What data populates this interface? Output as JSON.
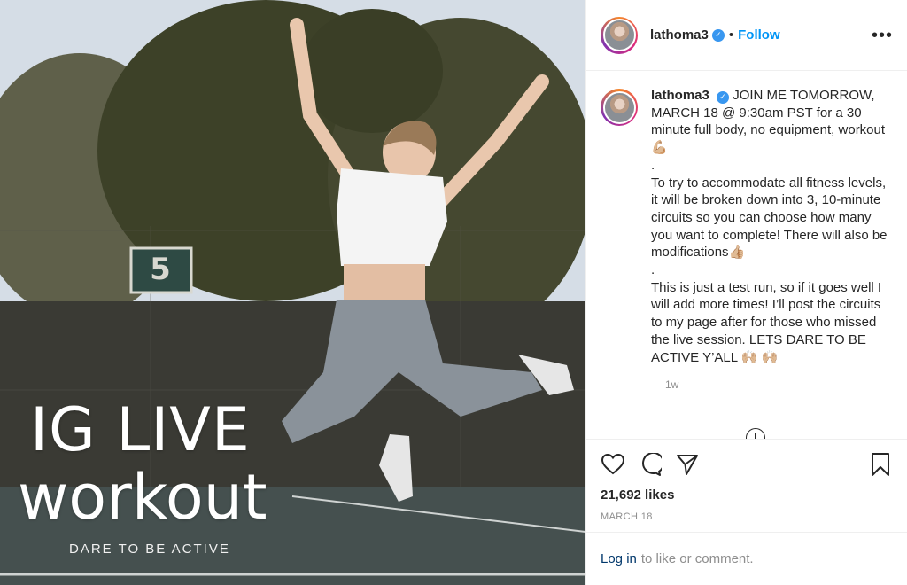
{
  "post": {
    "overlay_title": "IG LIVE",
    "overlay_subtitle": "workout",
    "overlay_tagline": "DARE TO BE ACTIVE",
    "court_sign": "5"
  },
  "header": {
    "username": "lathoma3",
    "verified_icon": "verified-badge-icon",
    "separator": "•",
    "follow_label": "Follow",
    "more_label": "•••"
  },
  "caption": {
    "username": "lathoma3",
    "text": "JOIN ME TOMORROW, MARCH 18 @ 9:30am PST for a 30 minute full body, no equipment, workout 💪🏼\n.\nTo try to accommodate all fitness levels, it will be broken down into 3, 10-minute circuits so you can choose how many you want to complete! There will also be modifications👍🏼\n.\nThis is just a test run, so if it goes well I will add more times! I’ll post the circuits to my page after for those who missed the live session. LETS DARE TO BE ACTIVE Y’ALL 🙌🏼 🙌🏼",
    "time": "1w"
  },
  "actions": {
    "like_icon": "heart-icon",
    "comment_icon": "comment-icon",
    "share_icon": "share-icon",
    "save_icon": "bookmark-icon",
    "likes": "21,692 likes",
    "date": "MARCH 18"
  },
  "footer": {
    "login_link": "Log in",
    "login_rest": "to like or comment."
  },
  "colors": {
    "link_blue": "#0095f6",
    "text": "#262626",
    "muted": "#8e8e8e",
    "border": "#efefef"
  }
}
